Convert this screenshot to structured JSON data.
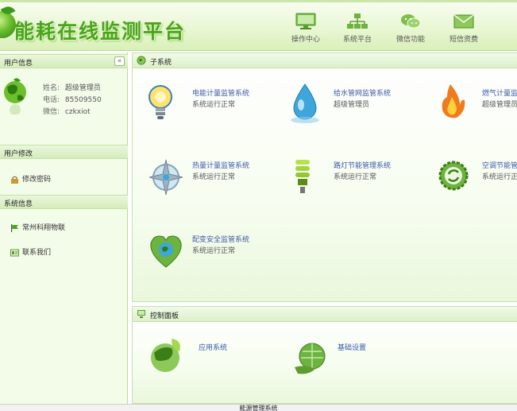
{
  "header": {
    "title": "能耗在线监测平台",
    "nav": [
      {
        "label": "操作中心",
        "icon": "monitor-icon"
      },
      {
        "label": "系统平台",
        "icon": "network-icon"
      },
      {
        "label": "微信功能",
        "icon": "wechat-icon"
      },
      {
        "label": "短信资费",
        "icon": "envelope-icon"
      }
    ]
  },
  "sidebar": {
    "user_info": {
      "heading": "用户信息",
      "collapse_label": "«",
      "name_label": "姓名:",
      "name_value": "超级管理员",
      "phone_label": "电话:",
      "phone_value": "85509550",
      "wechat_label": "微信:",
      "wechat_value": "czkxiot"
    },
    "user_edit": {
      "heading": "用户修改",
      "change_password": "修改密码"
    },
    "system_info": {
      "heading": "系统信息",
      "company_link": "常州科翔物联",
      "contact_link": "联系我们"
    }
  },
  "subsystems": {
    "heading": "子系统",
    "items": [
      {
        "name": "电能计量监管系统",
        "status": "系统运行正常",
        "icon": "lightbulb-icon"
      },
      {
        "name": "给水管网监管系统",
        "status": "超级管理员",
        "icon": "water-drop-icon"
      },
      {
        "name": "燃气计量监管",
        "status": "超级管理员",
        "icon": "flame-icon"
      },
      {
        "name": "热量计量监管系统",
        "status": "系统运行正常",
        "icon": "compass-icon"
      },
      {
        "name": "路灯节能管理系统",
        "status": "系统运行正常",
        "icon": "energy-saving-bulb-icon"
      },
      {
        "name": "空调节能管",
        "status": "系统运行正常",
        "icon": "recycle-gear-icon"
      },
      {
        "name": "配变安全监管系统",
        "status": "系统运行正常",
        "icon": "heart-globe-icon"
      }
    ]
  },
  "control_panel": {
    "heading": "控制面板",
    "items": [
      {
        "name": "应用系统",
        "icon": "leaf-globe-icon"
      },
      {
        "name": "基础设置",
        "icon": "globe-hand-icon"
      }
    ]
  },
  "footer": {
    "text": "能源管理系统"
  },
  "colors": {
    "accent": "#4aa51c",
    "header_bg": "#eaf7d5",
    "link": "#3b5aa8"
  }
}
